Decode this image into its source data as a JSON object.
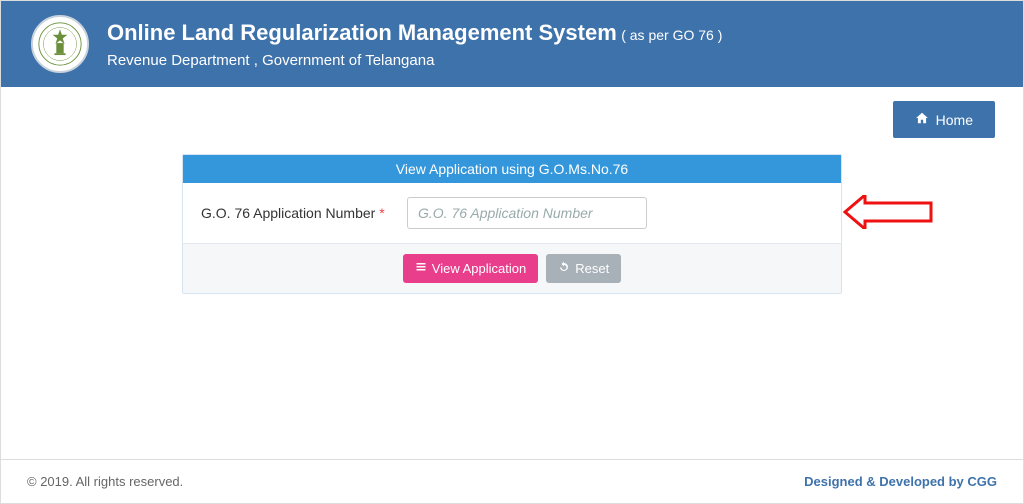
{
  "header": {
    "title": "Online Land Regularization Management System",
    "subtitle": "( as per GO 76 )",
    "department": "Revenue Department , Government of Telangana"
  },
  "nav": {
    "home_label": "Home"
  },
  "panel": {
    "title": "View Application using G.O.Ms.No.76",
    "field_label": "G.O. 76 Application Number",
    "field_required_mark": "*",
    "field_placeholder": "G.O. 76 Application Number",
    "field_value": "",
    "view_button": "View Application",
    "reset_button": "Reset"
  },
  "footer": {
    "copyright": "© 2019. All rights reserved.",
    "credit": "Designed & Developed by CGG"
  }
}
